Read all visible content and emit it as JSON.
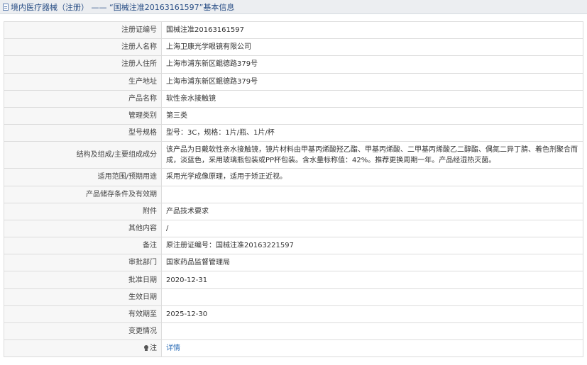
{
  "header": {
    "icon": "document-icon",
    "title_prefix": "境内医疗器械（注册）",
    "title_sep": "——",
    "title_main": "“国械注准20163161597”基本信息"
  },
  "rows": [
    {
      "label": "注册证编号",
      "value": "国械注准20163161597"
    },
    {
      "label": "注册人名称",
      "value": "上海卫康光学眼镜有限公司"
    },
    {
      "label": "注册人住所",
      "value": "上海市浦东新区鲲德路379号"
    },
    {
      "label": "生产地址",
      "value": "上海市浦东新区鲲德路379号"
    },
    {
      "label": "产品名称",
      "value": "软性亲水接触镜"
    },
    {
      "label": "管理类别",
      "value": "第三类"
    },
    {
      "label": "型号规格",
      "value": "型号：3C，规格：1片/瓶、1片/杯"
    },
    {
      "label": "结构及组成/主要组成成分",
      "value": "该产品为日戴软性亲水接触镜，镜片材料由甲基丙烯酸羟乙酯、甲基丙烯酸、二甲基丙烯酸乙二醇酯、偶氮二异丁腈、着色剂聚合而成，淡蓝色，采用玻璃瓶包装或PP杯包装。含水量标称值：42%。推荐更换周期一年。产品经湿热灭菌。"
    },
    {
      "label": "适用范围/预期用途",
      "value": "采用光学成像原理，适用于矫正近视。"
    },
    {
      "label": "产品储存条件及有效期",
      "value": ""
    },
    {
      "label": "附件",
      "value": "产品技术要求"
    },
    {
      "label": "其他内容",
      "value": "/"
    },
    {
      "label": "备注",
      "value": "原注册证编号：国械注准20163221597"
    },
    {
      "label": "审批部门",
      "value": "国家药品监督管理局"
    },
    {
      "label": "批准日期",
      "value": "2020-12-31"
    },
    {
      "label": "生效日期",
      "value": ""
    },
    {
      "label": "有效期至",
      "value": "2025-12-30"
    },
    {
      "label": "变更情况",
      "value": ""
    }
  ],
  "footer_row": {
    "label": "注",
    "icon": "lightbulb-icon",
    "link_text": "详情"
  }
}
